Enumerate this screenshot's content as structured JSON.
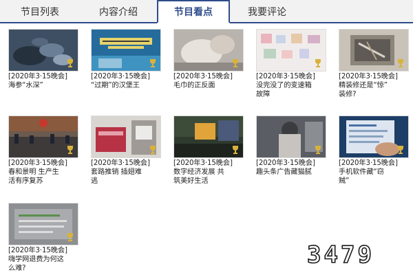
{
  "tabs": [
    {
      "label": "节目列表",
      "active": false
    },
    {
      "label": "内容介绍",
      "active": false
    },
    {
      "label": "节目看点",
      "active": true
    },
    {
      "label": "我要评论",
      "active": false
    }
  ],
  "accent_color": "#2e4b8a",
  "videos": [
    {
      "line1": "[2020年3·15晚会]",
      "line2": "海参“水深”",
      "line3": ""
    },
    {
      "line1": "[2020年3·15晚会]",
      "line2": "“过期”的汉堡王",
      "line3": ""
    },
    {
      "line1": "[2020年3·15晚会]",
      "line2": "毛巾的正反面",
      "line3": ""
    },
    {
      "line1": "[2020年3·15晚会]",
      "line2": "没完没了的变速箱",
      "line3": "故障"
    },
    {
      "line1": "[2020年3·15晚会]",
      "line2": "精装修还是“惊”",
      "line3": "装修?"
    },
    {
      "line1": "[2020年3·15晚会]",
      "line2": "春和景明 生产生",
      "line3": "活有序复苏"
    },
    {
      "line1": "[2020年3·15晚会]",
      "line2": "套路推销 插翅难",
      "line3": "逃"
    },
    {
      "line1": "[2020年3·15晚会]",
      "line2": "数字经济发展 共",
      "line3": "筑美好生活"
    },
    {
      "line1": "[2020年3·15晚会]",
      "line2": "趣头条广告藏猫腻",
      "line3": ""
    },
    {
      "line1": "[2020年3·15晚会]",
      "line2": "手机软件藏“窃",
      "line3": "贼”"
    },
    {
      "line1": "[2020年3·15晚会]",
      "line2": "嗨学网退费为何这",
      "line3": "么难?"
    }
  ],
  "watermark_text": "3479"
}
